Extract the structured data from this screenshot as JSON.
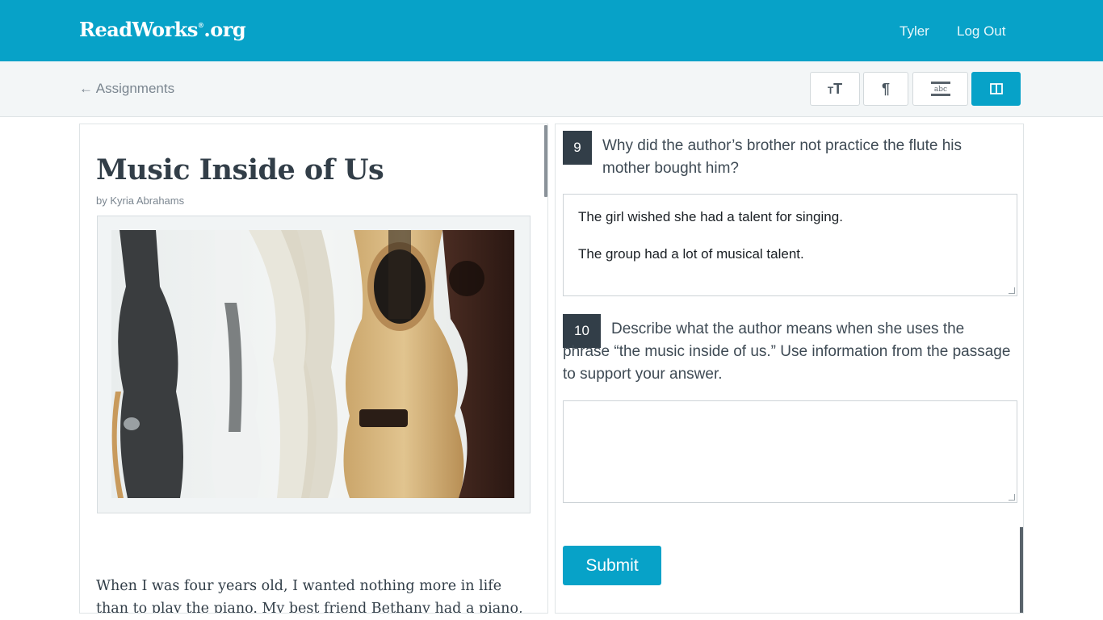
{
  "header": {
    "logo": "ReadWorks",
    "logo_suffix": ".org",
    "logo_mark": "®",
    "user_name": "Tyler",
    "logout_label": "Log Out"
  },
  "toolbar": {
    "back_label": "← Assignments",
    "buttons": [
      {
        "icon": "text-size-icon",
        "active": false
      },
      {
        "icon": "paragraph-icon",
        "active": false
      },
      {
        "icon": "highlight-abc-icon",
        "active": false
      },
      {
        "icon": "split-view-icon",
        "active": true
      }
    ],
    "highlight_glyph": "abc",
    "paragraph_glyph": "¶"
  },
  "article": {
    "title": "Music Inside of Us",
    "byline": "by Kyria Abrahams",
    "image_icon": "guitars-photo",
    "passage_start": "When I was four years old, I wanted nothing more in life than to play the piano. My best friend Bethany had a piano, but she"
  },
  "questions": [
    {
      "number": "9",
      "text": "Why did the author’s brother not practice the flute his mother bought him?",
      "answer_lines": [
        "The girl wished she had a talent for singing.",
        "The group had a lot of musical talent."
      ]
    },
    {
      "number": "10",
      "text": "Describe what the author means when she uses the phrase “the music inside of us.” Use information from the passage to support your answer.",
      "answer_lines": []
    }
  ],
  "submit_label": "Submit",
  "colors": {
    "brand": "#07a2c8",
    "dark": "#323e48",
    "toolbar_bg": "#f3f6f7"
  }
}
